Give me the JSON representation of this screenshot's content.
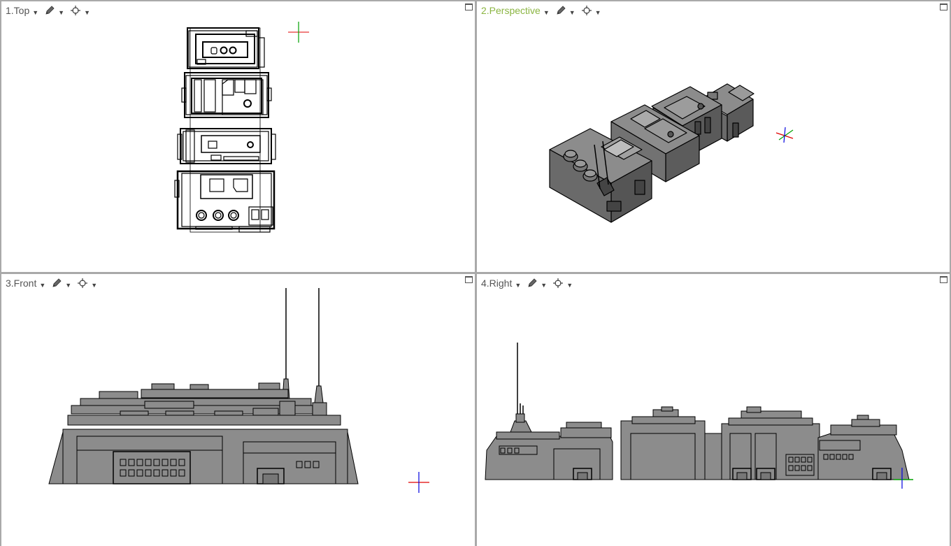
{
  "viewports": [
    {
      "id": "top",
      "title": "1.Top",
      "active": false
    },
    {
      "id": "perspective",
      "title": "2.Perspective",
      "active": true
    },
    {
      "id": "front",
      "title": "3.Front",
      "active": false
    },
    {
      "id": "right",
      "title": "4.Right",
      "active": false
    }
  ],
  "icons": {
    "display_mode": "pencil-icon",
    "object_snap": "crosshair-target-icon",
    "dropdown": "chevron-down-icon",
    "maximize": "maximize-icon"
  },
  "colors": {
    "active_title": "#8bb542",
    "inactive_title": "#555555",
    "model_fill": "#8c8c8c",
    "model_dark": "#4a4a4a",
    "model_stroke": "#000000",
    "axis_x": "#e00000",
    "axis_y": "#00a000",
    "axis_z": "#0000e0",
    "viewport_bg": "#ffffff",
    "frame_bg": "#a9a9a9"
  }
}
